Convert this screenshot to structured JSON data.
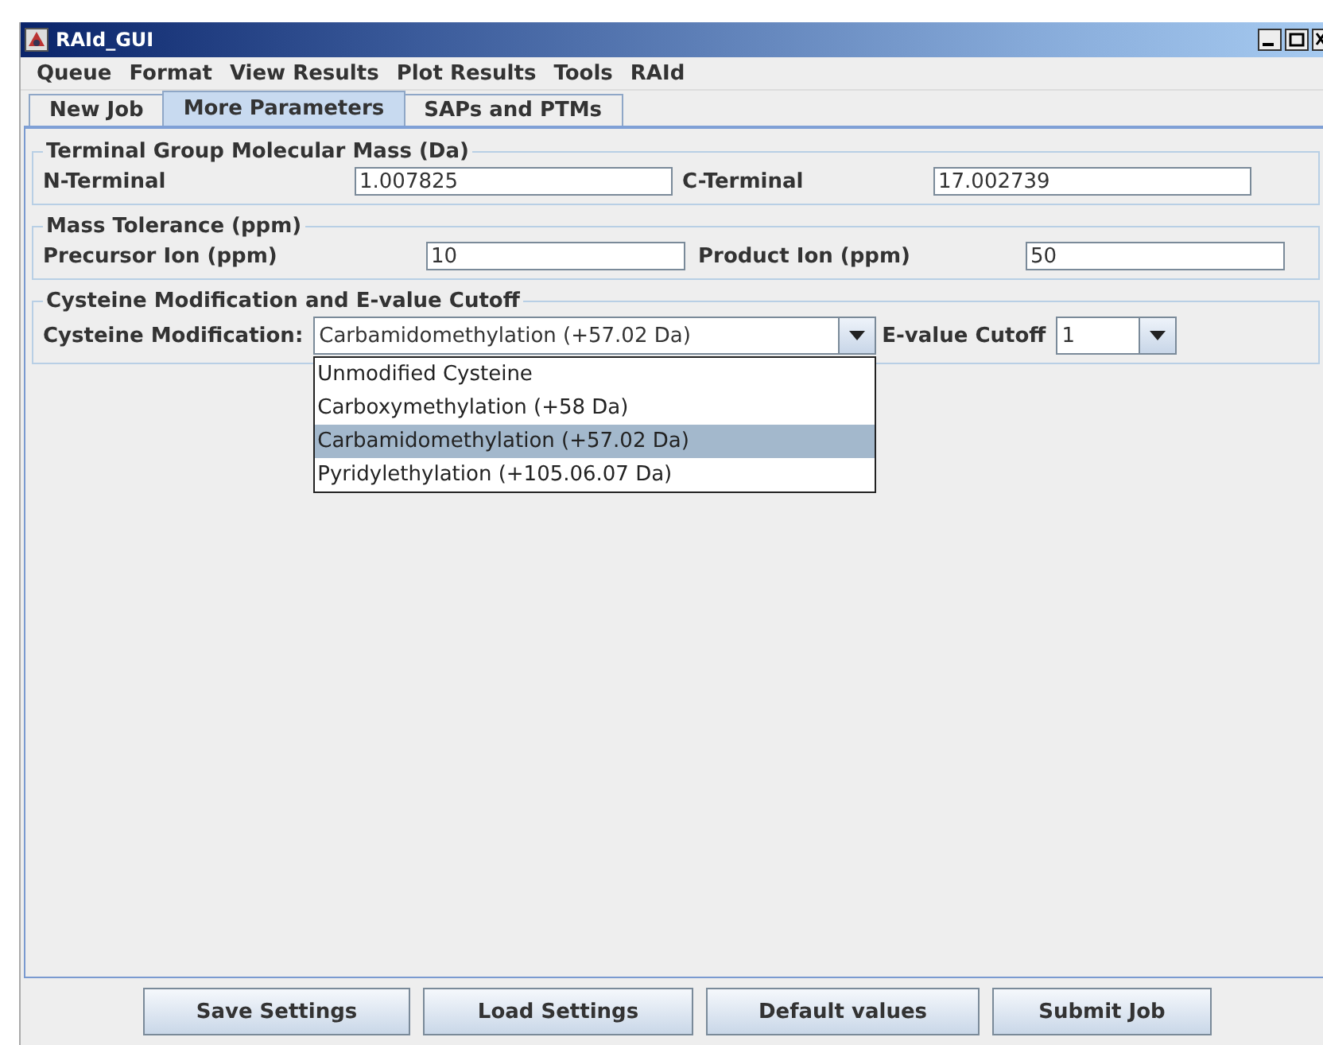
{
  "window": {
    "title": "RAId_GUI"
  },
  "menu": [
    "Queue",
    "Format",
    "View Results",
    "Plot Results",
    "Tools",
    "RAId"
  ],
  "tabs": [
    {
      "label": "New Job",
      "selected": false
    },
    {
      "label": "More Parameters",
      "selected": true
    },
    {
      "label": "SAPs and PTMs",
      "selected": false
    }
  ],
  "terminal_group": {
    "title": "Terminal Group Molecular Mass (Da)",
    "fields": [
      {
        "label": "N-Terminal",
        "value": "1.007825"
      },
      {
        "label": "C-Terminal",
        "value": "17.002739"
      }
    ]
  },
  "mass_tolerance": {
    "title": "Mass Tolerance (ppm)",
    "fields": [
      {
        "label": "Precursor Ion (ppm)",
        "value": "10"
      },
      {
        "label": "Product Ion (ppm)",
        "value": "50"
      }
    ]
  },
  "cysteine": {
    "title": "Cysteine Modification and E-value Cutoff",
    "modification_label": "Cysteine Modification:",
    "modification_value": "Carbamidomethylation (+57.02 Da)",
    "evalue_label": "E-value Cutoff",
    "evalue_value": "1",
    "options": [
      {
        "label": "Unmodified Cysteine",
        "selected": false
      },
      {
        "label": "Carboxymethylation (+58 Da)",
        "selected": false
      },
      {
        "label": "Carbamidomethylation (+57.02 Da)",
        "selected": true
      },
      {
        "label": "Pyridylethylation (+105.06.07 Da)",
        "selected": false
      }
    ]
  },
  "buttons": [
    "Save Settings",
    "Load Settings",
    "Default values",
    "Submit Job"
  ]
}
